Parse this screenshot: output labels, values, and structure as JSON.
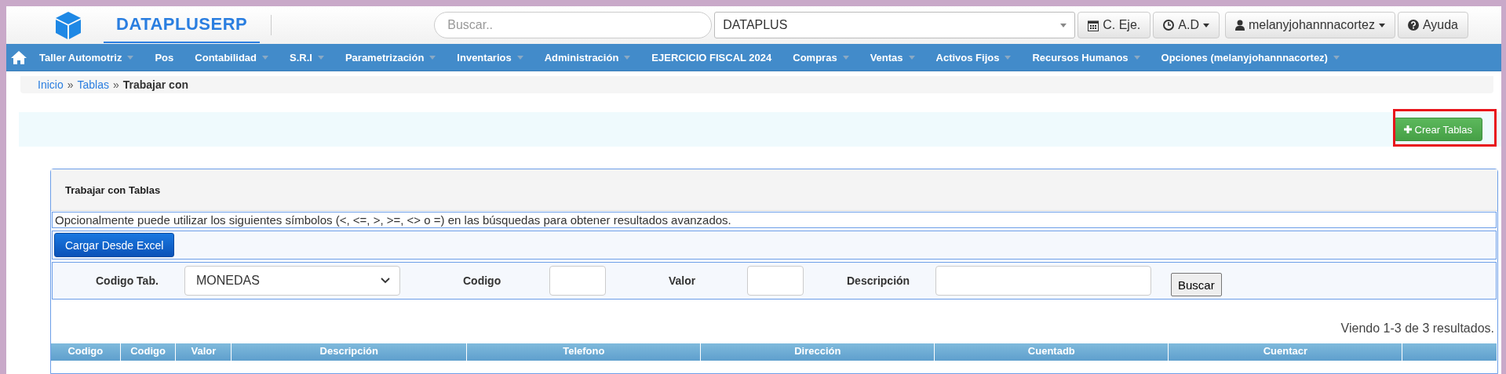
{
  "brand": {
    "name": "DATAPLUSERP"
  },
  "search": {
    "placeholder": "Buscar.."
  },
  "company_select": {
    "value": "DATAPLUS"
  },
  "top_buttons": [
    {
      "kind": "calendar",
      "label": "C. Eje.",
      "dropdown": false
    },
    {
      "kind": "clock",
      "label": "A.D",
      "dropdown": true
    },
    {
      "kind": "user",
      "label": "melanyjohannnacortez",
      "dropdown": true
    },
    {
      "kind": "help",
      "label": "Ayuda",
      "dropdown": false
    }
  ],
  "menu": [
    {
      "label": "Taller Automotriz",
      "dropdown": true
    },
    {
      "label": "Pos",
      "dropdown": false
    },
    {
      "label": "Contabilidad",
      "dropdown": true
    },
    {
      "label": "S.R.I",
      "dropdown": true
    },
    {
      "label": "Parametrización",
      "dropdown": true
    },
    {
      "label": "Inventarios",
      "dropdown": true
    },
    {
      "label": "Administración",
      "dropdown": true
    },
    {
      "label": "EJERCICIO FISCAL 2024",
      "dropdown": false
    },
    {
      "label": "Compras",
      "dropdown": true
    },
    {
      "label": "Ventas",
      "dropdown": true
    },
    {
      "label": "Activos Fijos",
      "dropdown": true
    },
    {
      "label": "Recursos Humanos",
      "dropdown": true
    },
    {
      "label": "Opciones (melanyjohannnacortez)",
      "dropdown": true
    }
  ],
  "breadcrumb": [
    {
      "label": "Inicio",
      "link": true
    },
    {
      "label": "»",
      "link": false
    },
    {
      "label": "Tablas",
      "link": true
    },
    {
      "label": "»",
      "link": false
    },
    {
      "label": "Trabajar con",
      "link": false
    }
  ],
  "create_button": {
    "label": "Crear Tablas",
    "highlighted": true
  },
  "panel": {
    "title": "Trabajar con Tablas",
    "hint": "Opcionalmente puede utilizar los siguientes símbolos (<, <=, >, >=, <> o =) en las búsquedas para obtener resultados avanzados.",
    "excel_button": "Cargar Desde Excel",
    "filters": [
      {
        "kind": "select",
        "label": "Codigo Tab.",
        "value": "MONEDAS"
      },
      {
        "kind": "text",
        "label": "Codigo"
      },
      {
        "kind": "text",
        "label": "Valor"
      },
      {
        "kind": "text",
        "label": "Descripción"
      }
    ],
    "search_button": "Buscar",
    "summary": "Viendo 1-3 de 3 resultados.",
    "table": {
      "columns": [
        "Codigo",
        "Codigo",
        "Valor",
        "Descripción",
        "Telefono",
        "Dirección",
        "Cuentadb",
        "Cuentacr",
        ""
      ]
    }
  }
}
